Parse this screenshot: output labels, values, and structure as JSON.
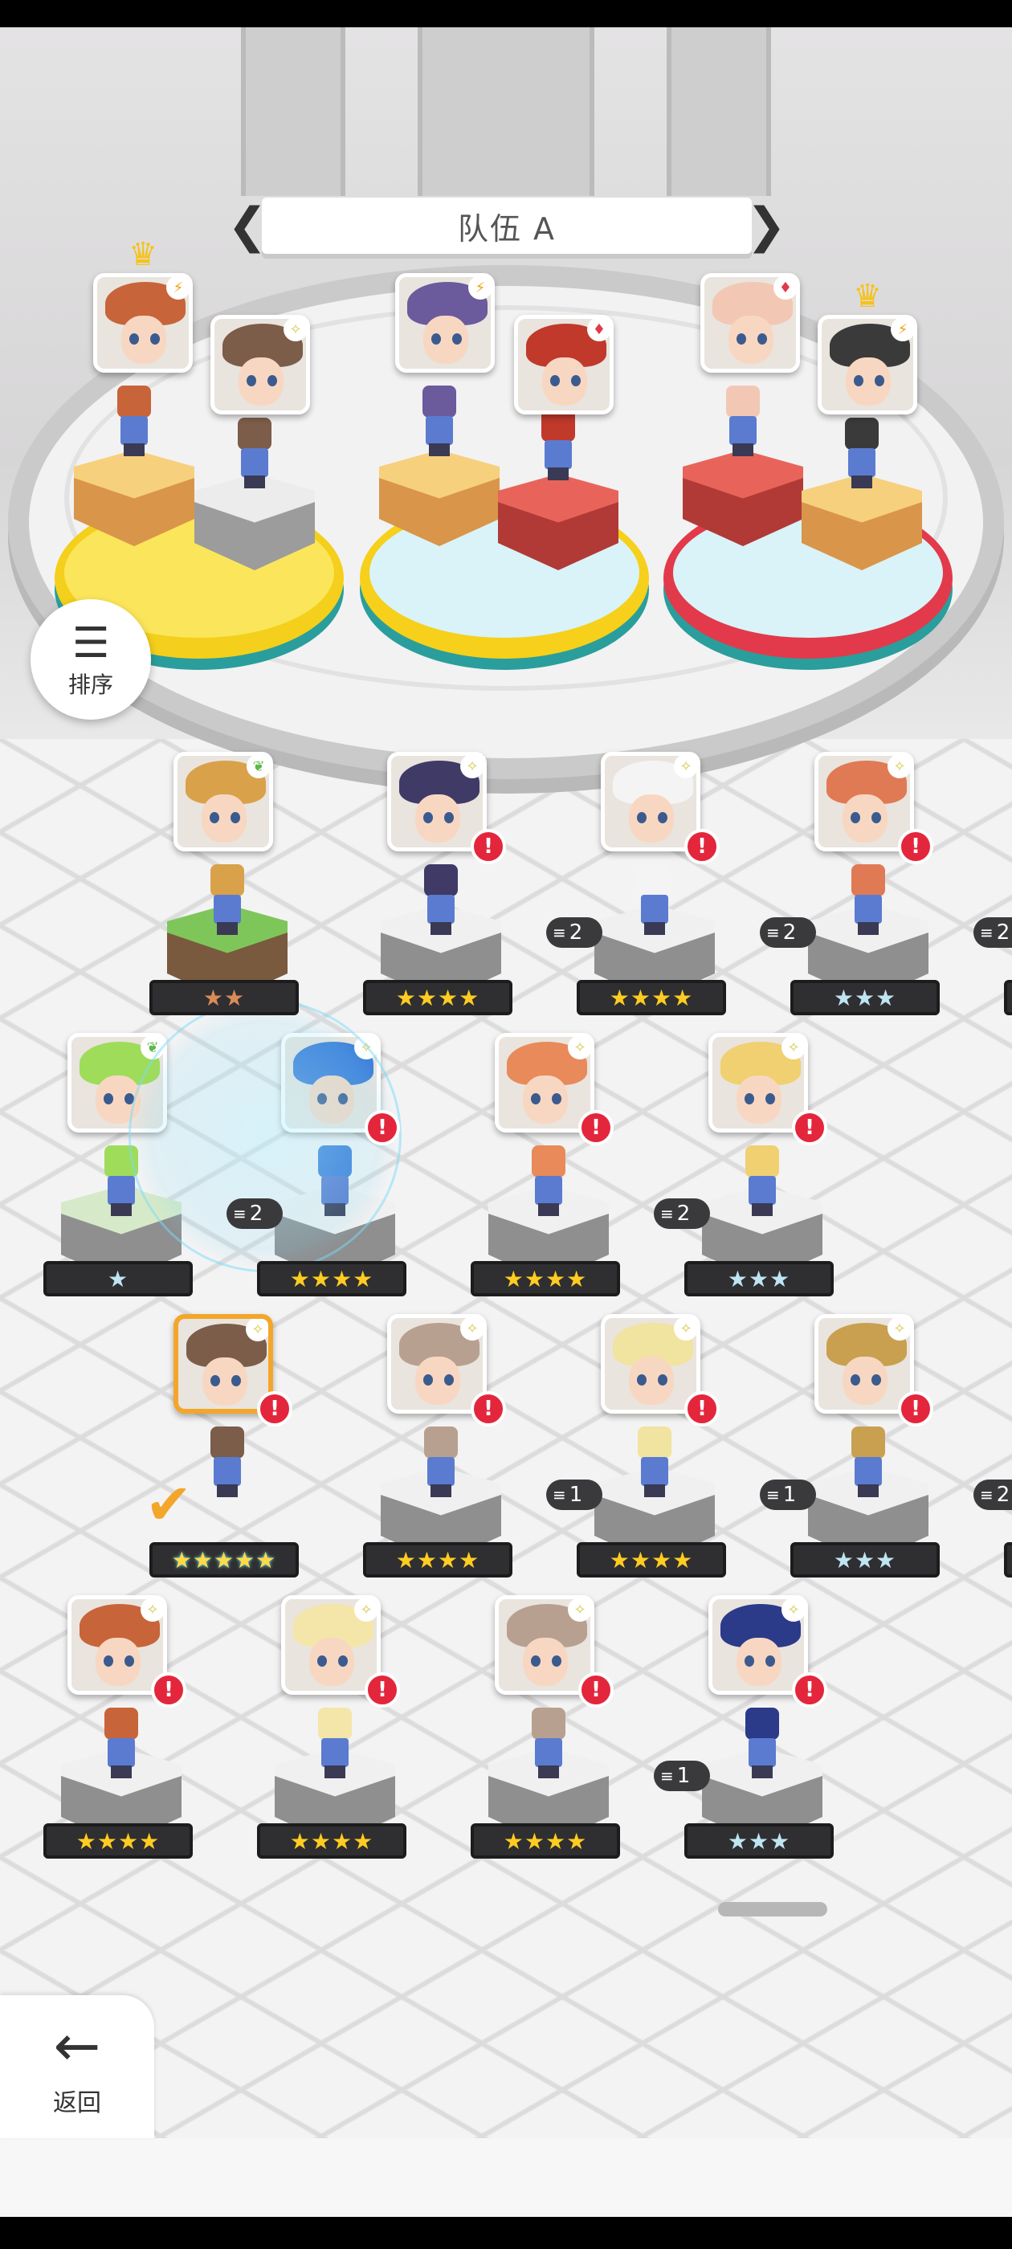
{
  "team": {
    "title": "队伍 A",
    "prev_icon": "chevron-left-icon",
    "next_icon": "chevron-right-icon",
    "members": [
      {
        "slot": 1,
        "element": "lightning",
        "leader": true,
        "hair": "#c8643a",
        "block": "gold"
      },
      {
        "slot": 2,
        "element": "light",
        "leader": false,
        "hair": "#7b5d49",
        "block": "grey"
      },
      {
        "slot": 3,
        "element": "lightning",
        "leader": false,
        "hair": "#6b5a9c",
        "block": "gold"
      },
      {
        "slot": 4,
        "element": "fire",
        "leader": false,
        "hair": "#c0392b",
        "block": "red"
      },
      {
        "slot": 5,
        "element": "fire",
        "leader": false,
        "hair": "#f2c8b4",
        "block": "red"
      },
      {
        "slot": 6,
        "element": "lightning",
        "leader": true,
        "hair": "#3a3a3a",
        "block": "gold"
      }
    ]
  },
  "sort_button": {
    "label": "排序",
    "icon": "sort-icon"
  },
  "back_button": {
    "label": "返回",
    "icon": "arrow-left-icon"
  },
  "colors": {
    "alert": "#e3263c",
    "gold_star": "#ffcc22",
    "silver_star": "#bfe4f2",
    "selected_border": "#f3a62a"
  },
  "roster": [
    {
      "row": 1,
      "col": 1,
      "stars": "★★",
      "rarity": "bronze",
      "alert": false,
      "level": "",
      "element": "wind",
      "hair": "#d9a14a",
      "block": "green"
    },
    {
      "row": 1,
      "col": 2,
      "stars": "★★★★",
      "rarity": "gold",
      "alert": true,
      "level": "",
      "element": "light",
      "hair": "#3f3a66",
      "block": "stone"
    },
    {
      "row": 1,
      "col": 3,
      "stars": "★★★★",
      "rarity": "gold",
      "alert": true,
      "level": "2",
      "element": "light",
      "hair": "#f4f4f4",
      "block": "stone"
    },
    {
      "row": 1,
      "col": 4,
      "stars": "★★★",
      "rarity": "silver",
      "alert": true,
      "level": "2",
      "element": "light",
      "hair": "#e07a55",
      "block": "stone"
    },
    {
      "row": 1,
      "col": 5,
      "stars": "★★★",
      "rarity": "silver",
      "alert": false,
      "level": "2",
      "element": "light",
      "hair": "#4a3a2a",
      "block": "stone"
    },
    {
      "row": 2,
      "col": 0,
      "stars": "★★★",
      "rarity": "silver",
      "alert": true,
      "level": "",
      "element": "wind",
      "hair": "#6fc04a",
      "block": "green"
    },
    {
      "row": 2,
      "col": 1,
      "stars": "★",
      "rarity": "silver",
      "alert": false,
      "level": "",
      "element": "wind",
      "hair": "#9fdc5a",
      "block": "greenstone"
    },
    {
      "row": 2,
      "col": 2,
      "stars": "★★★★",
      "rarity": "gold",
      "alert": true,
      "level": "2",
      "element": "light",
      "hair": "#3f7fd9",
      "block": "stone"
    },
    {
      "row": 2,
      "col": 3,
      "stars": "★★★★",
      "rarity": "gold",
      "alert": true,
      "level": "",
      "element": "light",
      "hair": "#e88a5a",
      "block": "stone"
    },
    {
      "row": 2,
      "col": 4,
      "stars": "★★★",
      "rarity": "silver",
      "alert": true,
      "level": "2",
      "element": "light",
      "hair": "#f0d070",
      "block": "stone"
    },
    {
      "row": 3,
      "col": 1,
      "stars": "★★★★★",
      "rarity": "rainbow",
      "alert": true,
      "level": "",
      "element": "light",
      "hair": "#7b5d49",
      "block": "ghost",
      "selected": true
    },
    {
      "row": 3,
      "col": 2,
      "stars": "★★★★",
      "rarity": "gold",
      "alert": true,
      "level": "",
      "element": "light",
      "hair": "#b8a090",
      "block": "stone"
    },
    {
      "row": 3,
      "col": 3,
      "stars": "★★★★",
      "rarity": "gold",
      "alert": true,
      "level": "1",
      "element": "light",
      "hair": "#f1e3a0",
      "block": "stone"
    },
    {
      "row": 3,
      "col": 4,
      "stars": "★★★",
      "rarity": "silver",
      "alert": true,
      "level": "1",
      "element": "light",
      "hair": "#c9a050",
      "block": "stone"
    },
    {
      "row": 3,
      "col": 5,
      "stars": "★★★",
      "rarity": "silver",
      "alert": false,
      "level": "2",
      "element": "light",
      "hair": "#4a3a2a",
      "block": "stone"
    },
    {
      "row": 4,
      "col": 0,
      "stars": "★★★",
      "rarity": "silver",
      "alert": true,
      "level": "",
      "element": "light",
      "hair": "#9fb08a",
      "block": "green"
    },
    {
      "row": 4,
      "col": 1,
      "stars": "★★★★",
      "rarity": "gold",
      "alert": true,
      "level": "",
      "element": "light",
      "hair": "#c8643a",
      "block": "stone"
    },
    {
      "row": 4,
      "col": 2,
      "stars": "★★★★",
      "rarity": "gold",
      "alert": true,
      "level": "",
      "element": "light",
      "hair": "#f3e6a8",
      "block": "stone"
    },
    {
      "row": 4,
      "col": 3,
      "stars": "★★★★",
      "rarity": "gold",
      "alert": true,
      "level": "",
      "element": "light",
      "hair": "#b8a090",
      "block": "stone"
    },
    {
      "row": 4,
      "col": 4,
      "stars": "★★★",
      "rarity": "silver",
      "alert": true,
      "level": "1",
      "element": "light",
      "hair": "#2c3a8a",
      "block": "stone"
    }
  ]
}
